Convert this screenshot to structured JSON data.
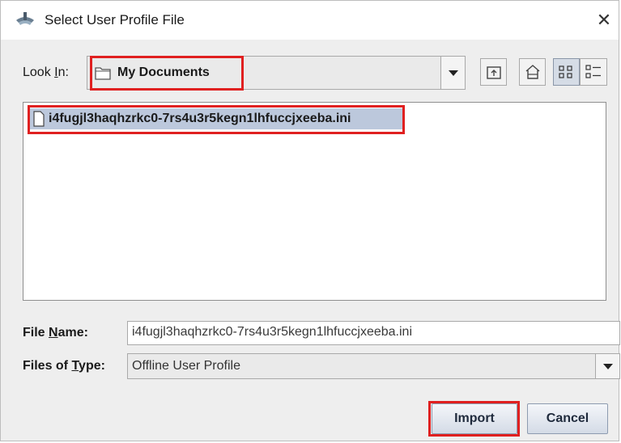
{
  "window": {
    "title": "Select User Profile File",
    "close_label": "✕"
  },
  "look_in": {
    "label_prefix": "Look ",
    "label_mnemonic": "I",
    "label_suffix": "n:",
    "value": "My Documents"
  },
  "toolbar": [
    "up-one-level-icon",
    "home-icon",
    "list-view-icon",
    "details-view-icon"
  ],
  "files": [
    {
      "name": "i4fugjl3haqhzrkc0-7rs4u3r5kegn1lhfuccjxeeba.ini"
    }
  ],
  "file_name": {
    "label_prefix": "File ",
    "label_mnemonic": "N",
    "label_suffix": "ame:",
    "value": "i4fugjl3haqhzrkc0-7rs4u3r5kegn1lhfuccjxeeba.ini"
  },
  "file_type": {
    "label_prefix": "Files of ",
    "label_mnemonic": "T",
    "label_suffix": "ype:",
    "value": "Offline User Profile"
  },
  "buttons": {
    "import_label": "Import",
    "cancel_label": "Cancel"
  },
  "colors": {
    "highlight": "#e02020",
    "selection": "#bcc8dc",
    "dialog_bg": "#eeeeee"
  }
}
